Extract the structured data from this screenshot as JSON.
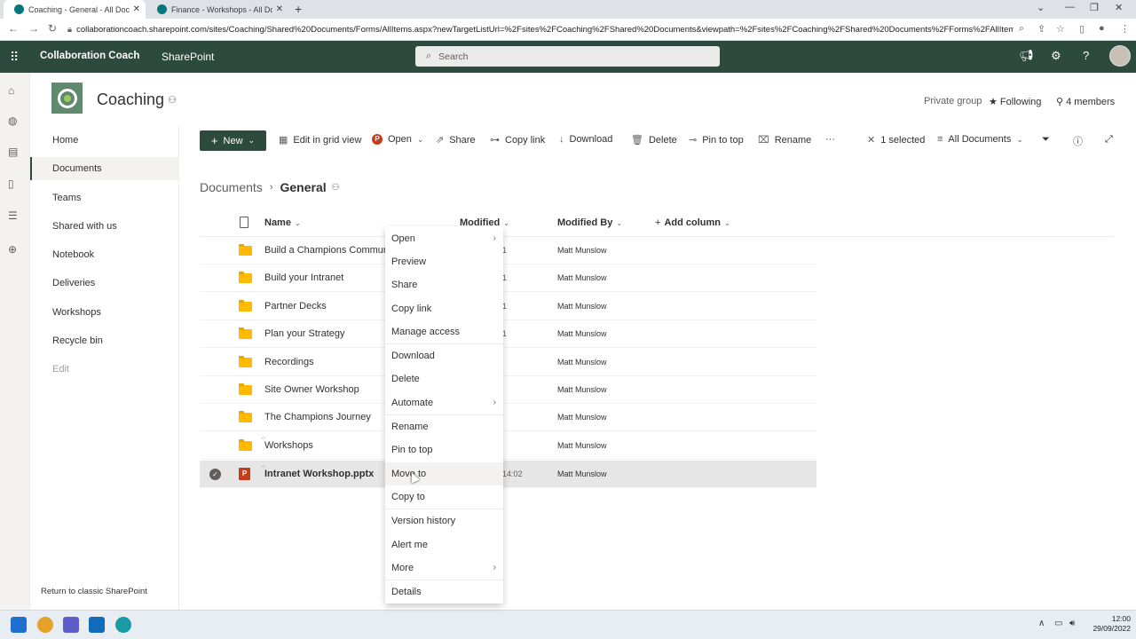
{
  "browser": {
    "tabs": [
      {
        "title": "Coaching - General - All Docume",
        "active": true
      },
      {
        "title": "Finance - Workshops - All Docum",
        "active": false
      }
    ],
    "url": "collaborationcoach.sharepoint.com/sites/Coaching/Shared%20Documents/Forms/AllItems.aspx?newTargetListUrl=%2Fsites%2FCoaching%2FShared%20Documents&viewpath=%2Fsites%2FCoaching%2FShared%20Documents%2FForms%2FAllItems%2Ea..."
  },
  "suitebar": {
    "org_name": "Collaboration Coach",
    "app_name": "SharePoint",
    "search_placeholder": "Search"
  },
  "site": {
    "title": "Coaching",
    "private_group": "Private group",
    "following": "Following",
    "members": "4 members"
  },
  "leftnav": {
    "items": [
      "Home",
      "Documents",
      "Teams",
      "Shared with us",
      "Notebook",
      "Deliveries",
      "Workshops",
      "Recycle bin"
    ],
    "edit": "Edit",
    "return_classic": "Return to classic SharePoint"
  },
  "commandbar": {
    "new": "New",
    "edit_grid": "Edit in grid view",
    "open": "Open",
    "share": "Share",
    "copy_link": "Copy link",
    "download": "Download",
    "delete": "Delete",
    "pin_to_top": "Pin to top",
    "rename": "Rename",
    "more": "···",
    "selected": "1 selected",
    "view": "All Documents"
  },
  "breadcrumb": {
    "root": "Documents",
    "current": "General"
  },
  "columns": {
    "name": "Name",
    "modified": "Modified",
    "modified_by": "Modified By",
    "add_column": "Add column"
  },
  "rows": [
    {
      "name": "Build a Champions Community",
      "modified": "1",
      "by": "Matt Munslow"
    },
    {
      "name": "Build your Intranet",
      "modified": "1",
      "by": "Matt Munslow"
    },
    {
      "name": "Partner Decks",
      "modified": "1",
      "by": "Matt Munslow"
    },
    {
      "name": "Plan your Strategy",
      "modified": "1",
      "by": "Matt Munslow"
    },
    {
      "name": "Recordings",
      "modified": "",
      "by": "Matt Munslow"
    },
    {
      "name": "Site Owner Workshop",
      "modified": "",
      "by": "Matt Munslow"
    },
    {
      "name": "The Champions Journey",
      "modified": "",
      "by": "Matt Munslow"
    },
    {
      "name": "Workshops",
      "modified": "",
      "by": "Matt Munslow"
    },
    {
      "name": "Intranet Workshop.pptx",
      "modified": "14:02",
      "by": "Matt Munslow"
    }
  ],
  "context_menu": {
    "items": [
      "Open",
      "Preview",
      "Share",
      "Copy link",
      "Manage access",
      "Download",
      "Delete",
      "Automate",
      "Rename",
      "Pin to top",
      "Move to",
      "Copy to",
      "Version history",
      "Alert me",
      "More",
      "Details"
    ]
  },
  "taskbar": {
    "time": "12:00",
    "date": "29/09/2022"
  },
  "colors": {
    "suitebar": "#2d4a3e",
    "accent": "#2d4a3e",
    "folder": "#ffb900",
    "powerpoint": "#c43e1c"
  }
}
